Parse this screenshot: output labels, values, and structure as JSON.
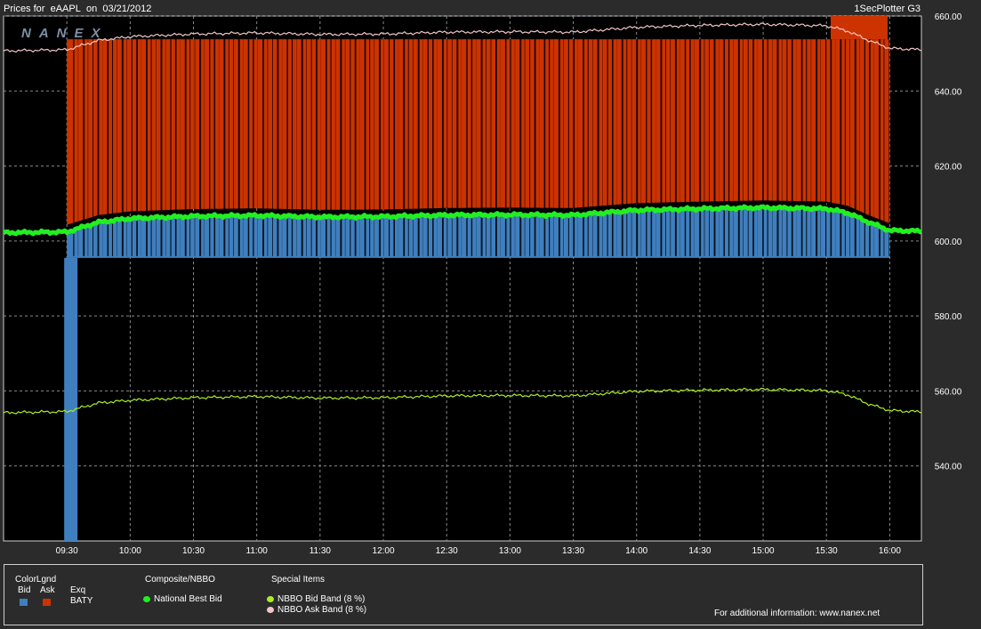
{
  "header": {
    "title_prefix": "Prices for",
    "symbol": "eAAPL",
    "date_prefix": "on",
    "date": "03/21/2012",
    "app_name": "1SecPlotter G3"
  },
  "watermark": "NANEX",
  "colors": {
    "background": "#000000",
    "frame": "#2b2b2b",
    "grid": "#8a8a8a",
    "bid": "#3f7fbf",
    "ask": "#cc3300",
    "nbb": "#22ee22",
    "bid_band": "#aaee22",
    "ask_band": "#f4c4c4"
  },
  "chart_data": {
    "type": "line",
    "title": "Prices for eAAPL on 03/21/2012",
    "x_ticks": [
      "09:30",
      "10:00",
      "10:30",
      "11:00",
      "11:30",
      "12:00",
      "12:30",
      "13:00",
      "13:30",
      "14:00",
      "14:30",
      "15:00",
      "15:30",
      "16:00"
    ],
    "y_ticks": [
      "540.00",
      "560.00",
      "580.00",
      "600.00",
      "620.00",
      "640.00",
      "660.00"
    ],
    "ylim": [
      520,
      660
    ],
    "xlim": [
      "09:00",
      "16:15"
    ],
    "grid": true,
    "series": [
      {
        "name": "National Best Bid",
        "x": [
          "09:00",
          "09:30",
          "09:45",
          "10:00",
          "10:30",
          "11:00",
          "11:30",
          "12:00",
          "12:30",
          "13:00",
          "13:30",
          "14:00",
          "14:30",
          "15:00",
          "15:30",
          "15:40",
          "15:50",
          "16:00",
          "16:15"
        ],
        "values": [
          602.2,
          602.4,
          605.0,
          606.0,
          606.6,
          606.8,
          606.4,
          606.5,
          606.9,
          607.0,
          606.9,
          608.2,
          608.6,
          608.9,
          608.6,
          607.5,
          605.0,
          602.8,
          602.6
        ]
      },
      {
        "name": "NBBO Bid Band (8 %)",
        "x": [
          "09:00",
          "09:30",
          "09:45",
          "10:00",
          "10:30",
          "11:00",
          "11:30",
          "12:00",
          "12:30",
          "13:00",
          "13:30",
          "14:00",
          "14:30",
          "15:00",
          "15:30",
          "15:40",
          "15:50",
          "16:00",
          "16:15"
        ],
        "values": [
          554.2,
          554.5,
          556.8,
          557.5,
          558.2,
          558.5,
          558.1,
          558.2,
          558.7,
          558.8,
          558.7,
          559.9,
          560.2,
          560.4,
          560.1,
          559.0,
          556.5,
          554.8,
          554.4
        ]
      },
      {
        "name": "NBBO Ask Band (8 %)",
        "x": [
          "09:00",
          "09:30",
          "09:45",
          "10:00",
          "10:30",
          "11:00",
          "11:30",
          "12:00",
          "12:30",
          "13:00",
          "13:30",
          "14:00",
          "14:30",
          "15:00",
          "15:30",
          "15:40",
          "15:50",
          "16:00",
          "16:15"
        ],
        "values": [
          650.7,
          651.0,
          653.5,
          654.5,
          655.2,
          655.5,
          655.1,
          655.2,
          655.7,
          655.8,
          655.7,
          657.0,
          657.5,
          657.8,
          657.4,
          656.0,
          653.5,
          651.4,
          651.0
        ]
      }
    ],
    "bid_region": {
      "exchange": "BATY",
      "bottom": 595.5
    },
    "ask_region": {
      "exchange": "BATY",
      "top": 653.8
    }
  },
  "legend": {
    "color_title": "ColorLgnd",
    "bid_label": "Bid",
    "ask_label": "Ask",
    "exq_label": "Exq",
    "exchange": "BATY",
    "composite_title": "Composite/NBBO",
    "nbb_label": "National Best Bid",
    "special_title": "Special Items",
    "bid_band_label": "NBBO Bid Band (8 %)",
    "ask_band_label": "NBBO Ask Band (8 %)",
    "footer": "For additional information: www.nanex.net"
  }
}
